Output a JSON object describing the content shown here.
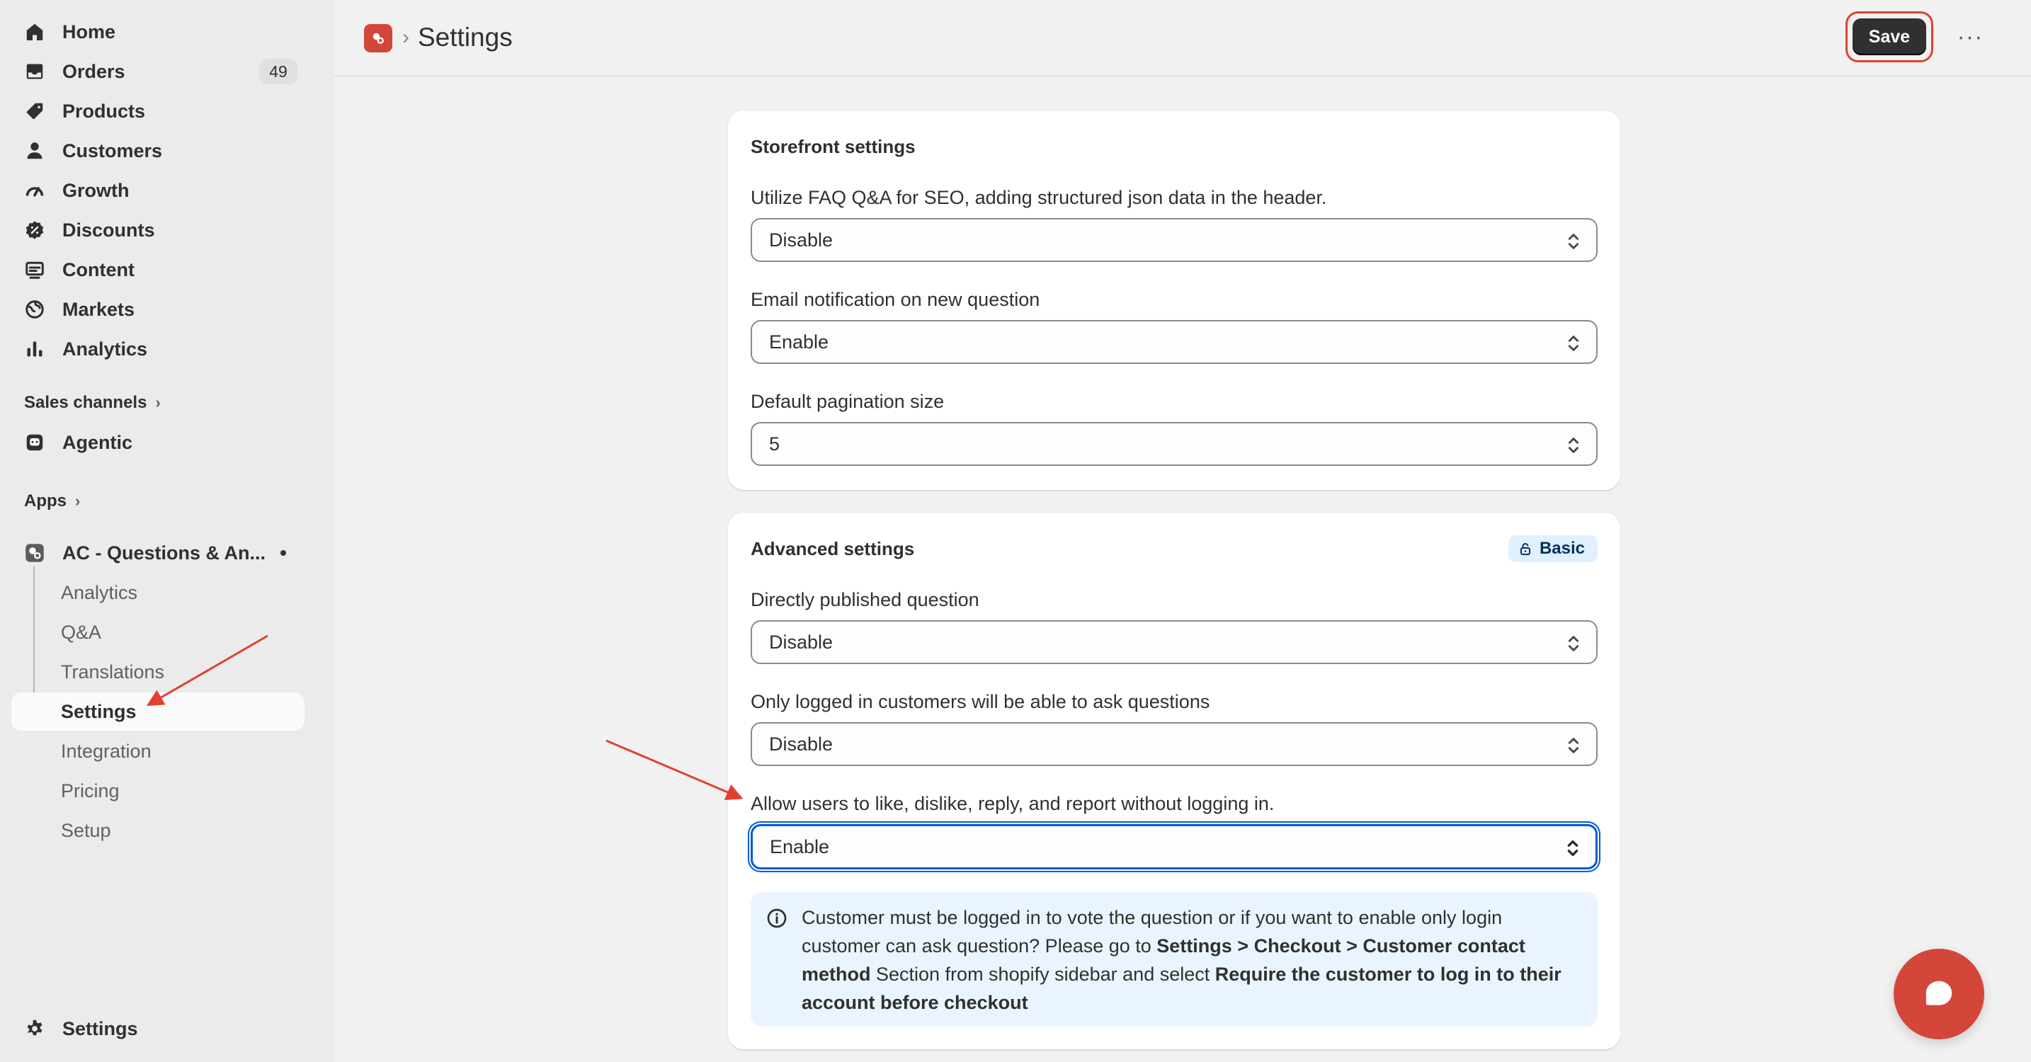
{
  "sidebar": {
    "items": [
      {
        "label": "Home",
        "icon": "home-icon"
      },
      {
        "label": "Orders",
        "icon": "inbox-icon",
        "badge": "49"
      },
      {
        "label": "Products",
        "icon": "tag-icon"
      },
      {
        "label": "Customers",
        "icon": "person-icon"
      },
      {
        "label": "Growth",
        "icon": "gauge-icon"
      },
      {
        "label": "Discounts",
        "icon": "discount-icon"
      },
      {
        "label": "Content",
        "icon": "content-icon"
      },
      {
        "label": "Markets",
        "icon": "globe-icon"
      },
      {
        "label": "Analytics",
        "icon": "bar-chart-icon"
      }
    ],
    "sales_channels_label": "Sales channels",
    "agentic_label": "Agentic",
    "apps_label": "Apps",
    "app_name": "AC - Questions & An...",
    "app_subitems": [
      "Analytics",
      "Q&A",
      "Translations",
      "Settings",
      "Integration",
      "Pricing",
      "Setup"
    ],
    "settings_label": "Settings"
  },
  "header": {
    "title": "Settings",
    "save_label": "Save",
    "more_label": "···"
  },
  "storefront": {
    "title": "Storefront settings",
    "fields": [
      {
        "label": "Utilize FAQ Q&A for SEO, adding structured json data in the header.",
        "value": "Disable"
      },
      {
        "label": "Email notification on new question",
        "value": "Enable"
      },
      {
        "label": "Default pagination size",
        "value": "5"
      }
    ]
  },
  "advanced": {
    "title": "Advanced settings",
    "plan_badge": "Basic",
    "fields": [
      {
        "label": "Directly published question",
        "value": "Disable"
      },
      {
        "label": "Only logged in customers will be able to ask questions",
        "value": "Disable"
      },
      {
        "label": "Allow users to like, dislike, reply, and report without logging in.",
        "value": "Enable"
      }
    ],
    "info": {
      "t1": "Customer must be logged in to vote the question or if you want to enable only login customer can ask question? Please go to ",
      "b1": "Settings > Checkout > Customer contact method",
      "t2": " Section from shopify sidebar and select ",
      "b2": "Require the customer to log in to their account before checkout"
    }
  },
  "colors": {
    "accent": "#303030",
    "brand": "#d4463a",
    "focus": "#005bd3",
    "annotation": "#e0412f",
    "info_bg": "#eaf4ff"
  }
}
